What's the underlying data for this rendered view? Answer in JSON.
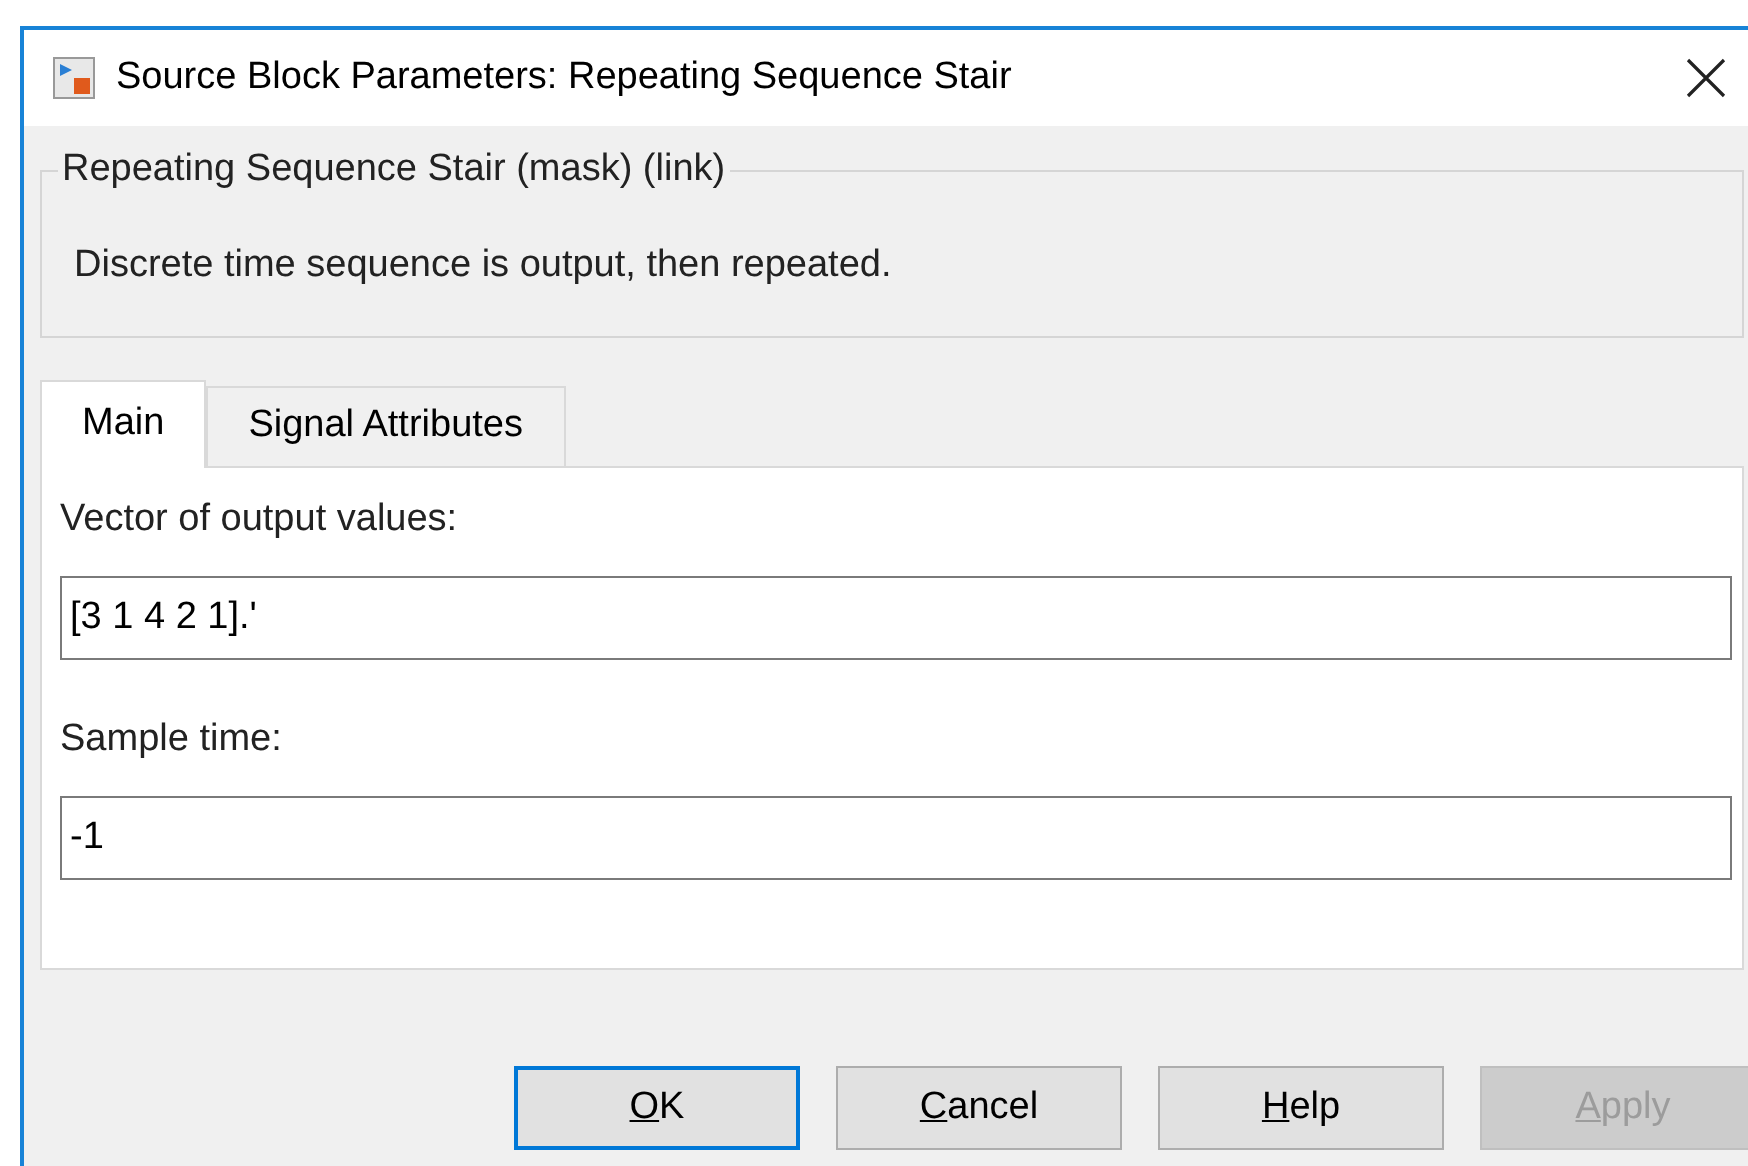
{
  "window": {
    "title": "Source Block Parameters: Repeating Sequence Stair"
  },
  "group": {
    "title": "Repeating Sequence Stair (mask) (link)",
    "description": "Discrete time sequence is output, then repeated."
  },
  "tabs": [
    {
      "label": "Main",
      "selected": true
    },
    {
      "label": "Signal Attributes",
      "selected": false
    }
  ],
  "fields": [
    {
      "label": "Vector of output values:",
      "value": "[3 1 4 2 1].'"
    },
    {
      "label": "Sample time:",
      "value": "-1"
    }
  ],
  "buttons": [
    {
      "mnemonic": "O",
      "rest": "K",
      "default": true,
      "disabled": false
    },
    {
      "mnemonic": "C",
      "rest": "ancel",
      "default": false,
      "disabled": false
    },
    {
      "mnemonic": "H",
      "rest": "elp",
      "default": false,
      "disabled": false
    },
    {
      "mnemonic": "A",
      "rest": "pply",
      "default": false,
      "disabled": true
    }
  ]
}
